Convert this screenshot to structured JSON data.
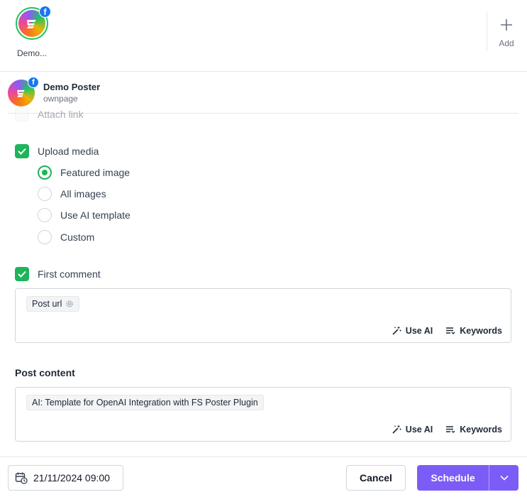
{
  "accounts_bar": {
    "accounts": [
      {
        "name": "Demo...",
        "network": "facebook",
        "selected": true
      }
    ],
    "add_label": "Add",
    "add_icon": "plus-icon"
  },
  "channel": {
    "name": "Demo Poster",
    "type": "ownpage",
    "network": "facebook"
  },
  "options": {
    "attach_link": {
      "label": "Attach link",
      "checked": false
    },
    "upload_media": {
      "label": "Upload media",
      "checked": true,
      "choices": [
        {
          "label": "Featured image",
          "selected": true
        },
        {
          "label": "All images",
          "selected": false
        },
        {
          "label": "Use AI template",
          "selected": false
        },
        {
          "label": "Custom",
          "selected": false
        }
      ]
    },
    "first_comment": {
      "label": "First comment",
      "checked": true,
      "tag": "Post url",
      "use_ai": "Use AI",
      "keywords": "Keywords"
    }
  },
  "post_content": {
    "label": "Post content",
    "tag": "AI: Template for OpenAI Integration with FS Poster Plugin",
    "use_ai": "Use AI",
    "keywords": "Keywords"
  },
  "footer": {
    "date": "21/11/2024 09:00",
    "cancel": "Cancel",
    "schedule": "Schedule"
  },
  "colors": {
    "accent_green": "#1eb45a",
    "schedule_purple": "#7c5cf6",
    "facebook_blue": "#1877f2"
  }
}
